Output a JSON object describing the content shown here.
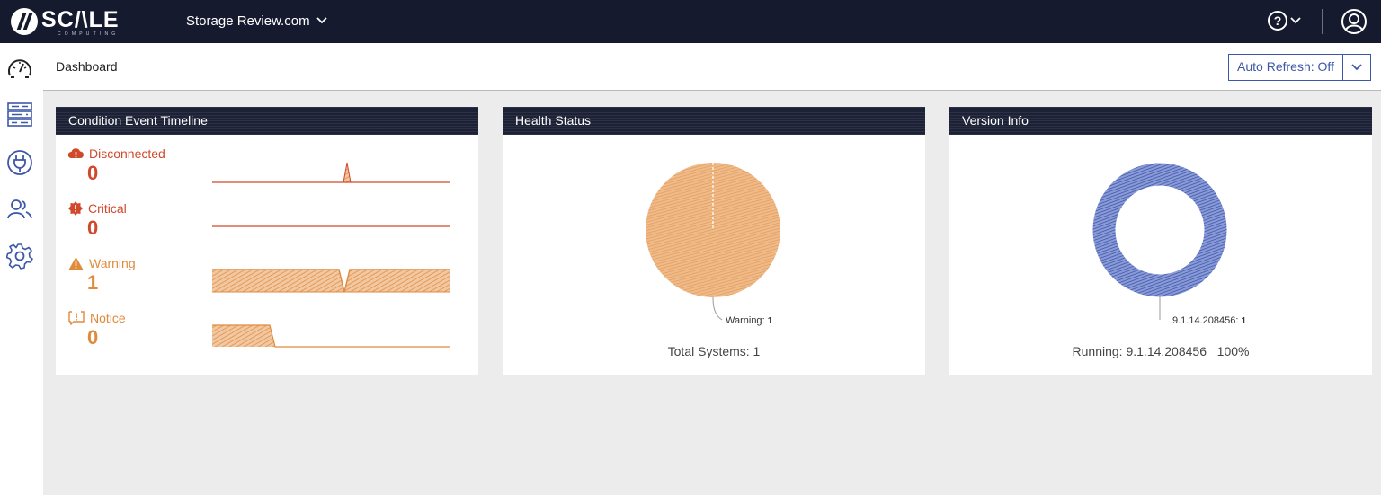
{
  "app": {
    "logo_text": "SC/\\LE",
    "logo_sub": "COMPUTING",
    "cluster_name": "Storage Review.com"
  },
  "nav": {
    "items": [
      {
        "name": "dashboard",
        "icon": "speedometer-icon"
      },
      {
        "name": "nodes",
        "icon": "server-rack-icon"
      },
      {
        "name": "connections",
        "icon": "plug-icon"
      },
      {
        "name": "users",
        "icon": "users-icon"
      },
      {
        "name": "settings",
        "icon": "gear-icon"
      }
    ]
  },
  "header": {
    "title": "Dashboard",
    "auto_refresh_label": "Auto Refresh: Off"
  },
  "condition_timeline": {
    "title": "Condition Event Timeline",
    "events": [
      {
        "label": "Disconnected",
        "count": "0",
        "severity": "red",
        "icon": "cloud-alert-icon"
      },
      {
        "label": "Critical",
        "count": "0",
        "severity": "red",
        "icon": "critical-badge-icon"
      },
      {
        "label": "Warning",
        "count": "1",
        "severity": "orange",
        "icon": "warning-triangle-icon"
      },
      {
        "label": "Notice",
        "count": "0",
        "severity": "orange",
        "icon": "notice-flag-icon"
      }
    ]
  },
  "health_status": {
    "title": "Health Status",
    "label_name": "Warning",
    "label_value": "1",
    "summary": "Total Systems: 1"
  },
  "version_info": {
    "title": "Version Info",
    "label_name": "9.1.14.208456",
    "label_value": "1",
    "summary": "Running: 9.1.14.208456   100%"
  },
  "chart_data": [
    {
      "type": "pie",
      "title": "Health Status",
      "categories": [
        "Warning"
      ],
      "values": [
        1
      ],
      "colors": [
        "#e8a56a"
      ]
    },
    {
      "type": "pie",
      "title": "Version Info",
      "categories": [
        "9.1.14.208456"
      ],
      "values": [
        1
      ],
      "colors": [
        "#4a62b5"
      ],
      "donut": true
    }
  ],
  "colors": {
    "topbar": "#161a2e",
    "accent_blue": "#3d58a8",
    "red": "#d0492b",
    "orange": "#e08a3c"
  }
}
